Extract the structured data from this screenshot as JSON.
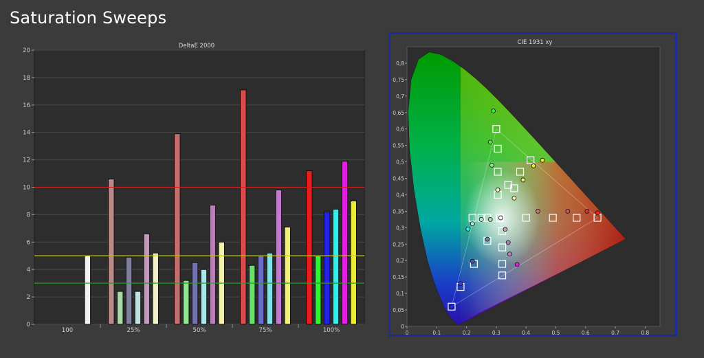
{
  "page": {
    "title": "Saturation Sweeps"
  },
  "chart_data": [
    {
      "type": "bar",
      "title": "DeltaE 2000",
      "categories": [
        "100",
        "25%",
        "50%",
        "75%",
        "100%"
      ],
      "ylim": [
        0,
        20
      ],
      "yticks": [
        0,
        2,
        4,
        6,
        8,
        10,
        12,
        14,
        16,
        18,
        20
      ],
      "grid": true,
      "bar_groups": [
        {
          "category": "100",
          "bars": [
            {
              "color": "#f2f2f2",
              "value": 5.0
            }
          ]
        },
        {
          "category": "25%",
          "bars": [
            {
              "color": "#b88a8a",
              "value": 10.6
            },
            {
              "color": "#a6dba6",
              "value": 2.4
            },
            {
              "color": "#80809c",
              "value": 4.9
            },
            {
              "color": "#bde2e2",
              "value": 2.4
            },
            {
              "color": "#c09ab9",
              "value": 6.6
            },
            {
              "color": "#f1efc6",
              "value": 5.2
            }
          ]
        },
        {
          "category": "50%",
          "bars": [
            {
              "color": "#c56e6e",
              "value": 13.9
            },
            {
              "color": "#8ee68e",
              "value": 3.2
            },
            {
              "color": "#7373ad",
              "value": 4.5
            },
            {
              "color": "#a6e7ee",
              "value": 4.0
            },
            {
              "color": "#b87eb6",
              "value": 8.7
            },
            {
              "color": "#f3f0a8",
              "value": 6.0
            }
          ]
        },
        {
          "category": "75%",
          "bars": [
            {
              "color": "#d94c4c",
              "value": 17.1
            },
            {
              "color": "#66e366",
              "value": 4.3
            },
            {
              "color": "#6d6dcb",
              "value": 5.0
            },
            {
              "color": "#7ae5ec",
              "value": 5.2
            },
            {
              "color": "#c37bd2",
              "value": 9.8
            },
            {
              "color": "#f2ee7c",
              "value": 7.1
            }
          ]
        },
        {
          "category": "100%",
          "bars": [
            {
              "color": "#e81e1e",
              "value": 11.2
            },
            {
              "color": "#2ef62e",
              "value": 5.0
            },
            {
              "color": "#2424e6",
              "value": 8.2
            },
            {
              "color": "#30eeee",
              "value": 8.4
            },
            {
              "color": "#e31ee3",
              "value": 11.9
            },
            {
              "color": "#ecec2a",
              "value": 9.0
            }
          ]
        }
      ],
      "reference_lines": [
        {
          "value": 10,
          "color": "#cc2222"
        },
        {
          "value": 5,
          "color": "#c8c820"
        },
        {
          "value": 3,
          "color": "#2a9a2a"
        }
      ]
    },
    {
      "type": "scatter",
      "title": "CIE 1931 xy",
      "xlim": [
        0,
        0.85
      ],
      "ylim": [
        0,
        0.85
      ],
      "xticks": [
        "0",
        "0,1",
        "0,2",
        "0,3",
        "0,4",
        "0,5",
        "0,6",
        "0,7",
        "0,8"
      ],
      "yticks": [
        "0",
        "0,05",
        "0,1",
        "0,15",
        "0,2",
        "0,25",
        "0,3",
        "0,35",
        "0,4",
        "0,45",
        "0,5",
        "0,55",
        "0,6",
        "0,65",
        "0,7",
        "0,75",
        "0,8"
      ],
      "gamut_triangle": [
        [
          0.64,
          0.33
        ],
        [
          0.3,
          0.6
        ],
        [
          0.15,
          0.06
        ]
      ],
      "target_squares": [
        [
          0.3127,
          0.329
        ],
        [
          0.4,
          0.33
        ],
        [
          0.49,
          0.33
        ],
        [
          0.57,
          0.33
        ],
        [
          0.64,
          0.33
        ],
        [
          0.305,
          0.4
        ],
        [
          0.305,
          0.47
        ],
        [
          0.305,
          0.54
        ],
        [
          0.3,
          0.6
        ],
        [
          0.22,
          0.33
        ],
        [
          0.25,
          0.33
        ],
        [
          0.27,
          0.33
        ],
        [
          0.27,
          0.26
        ],
        [
          0.225,
          0.19
        ],
        [
          0.18,
          0.12
        ],
        [
          0.15,
          0.06
        ],
        [
          0.32,
          0.29
        ],
        [
          0.32,
          0.24
        ],
        [
          0.32,
          0.19
        ],
        [
          0.32,
          0.155
        ],
        [
          0.34,
          0.43
        ],
        [
          0.36,
          0.42
        ],
        [
          0.38,
          0.47
        ],
        [
          0.415,
          0.505
        ]
      ],
      "measured_points": [
        {
          "x": 0.315,
          "y": 0.33,
          "color": "#f2f2f2"
        },
        {
          "x": 0.44,
          "y": 0.35,
          "color": "#d07070"
        },
        {
          "x": 0.54,
          "y": 0.35,
          "color": "#e05050"
        },
        {
          "x": 0.605,
          "y": 0.35,
          "color": "#ee3030"
        },
        {
          "x": 0.64,
          "y": 0.345,
          "color": "#ff2020"
        },
        {
          "x": 0.28,
          "y": 0.325,
          "color": "#a6dba6"
        },
        {
          "x": 0.285,
          "y": 0.49,
          "color": "#8ee68e"
        },
        {
          "x": 0.28,
          "y": 0.56,
          "color": "#66e366"
        },
        {
          "x": 0.29,
          "y": 0.655,
          "color": "#2ef62e"
        },
        {
          "x": 0.27,
          "y": 0.265,
          "color": "#80809c"
        },
        {
          "x": 0.22,
          "y": 0.198,
          "color": "#5a5aad"
        },
        {
          "x": 0.18,
          "y": 0.13,
          "color": "#4040cb"
        },
        {
          "x": 0.15,
          "y": 0.06,
          "color": "#2424e6"
        },
        {
          "x": 0.25,
          "y": 0.325,
          "color": "#bde2e2"
        },
        {
          "x": 0.22,
          "y": 0.312,
          "color": "#a6e7ee"
        },
        {
          "x": 0.205,
          "y": 0.296,
          "color": "#30eeee"
        },
        {
          "x": 0.33,
          "y": 0.295,
          "color": "#c09ab9"
        },
        {
          "x": 0.34,
          "y": 0.255,
          "color": "#b87eb6"
        },
        {
          "x": 0.345,
          "y": 0.22,
          "color": "#c37bd2"
        },
        {
          "x": 0.37,
          "y": 0.188,
          "color": "#e31ee3"
        },
        {
          "x": 0.305,
          "y": 0.415,
          "color": "#f1efc6"
        },
        {
          "x": 0.36,
          "y": 0.39,
          "color": "#f3f0a8"
        },
        {
          "x": 0.39,
          "y": 0.445,
          "color": "#f2ee7c"
        },
        {
          "x": 0.455,
          "y": 0.505,
          "color": "#ecec2a"
        },
        {
          "x": 0.425,
          "y": 0.488,
          "color": "#ecec2a"
        }
      ]
    }
  ]
}
